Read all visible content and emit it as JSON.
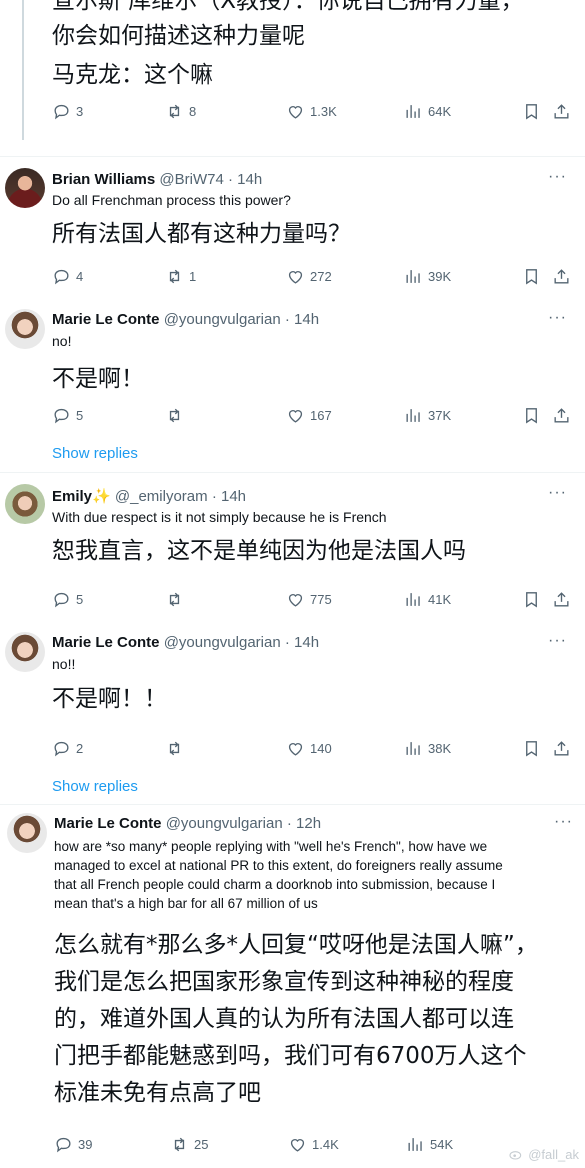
{
  "top_tweet": {
    "cut_line": "宣尔斯 库维尔（X教授）：你说自己拥有力量，",
    "text_lines": [
      "你会如何描述这种力量呢",
      "马克龙：这个嘛"
    ],
    "stats": {
      "replies": "3",
      "retweets": "8",
      "likes": "1.3K",
      "views": "64K"
    }
  },
  "tweets": [
    {
      "name": "Brian Williams",
      "handle": "@BriW74",
      "time": "14h",
      "text": "Do all Frenchman process this power?",
      "translation": [
        "所有法国人都有这种力量吗？"
      ],
      "stats": {
        "replies": "4",
        "retweets": "1",
        "likes": "272",
        "views": "39K"
      }
    },
    {
      "name": "Marie Le Conte",
      "handle": "@youngvulgarian",
      "time": "14h",
      "text": "no!",
      "translation": [
        "不是啊！"
      ],
      "stats": {
        "replies": "5",
        "retweets": "",
        "likes": "167",
        "views": "37K"
      },
      "show_replies": "Show replies"
    },
    {
      "name": "Emily",
      "badge": "✨",
      "handle": "@_emilyoram",
      "time": "14h",
      "text": "With due respect is it not simply because he is French",
      "translation": [
        "恕我直言，这不是单纯因为他是法国人吗"
      ],
      "stats": {
        "replies": "5",
        "retweets": "",
        "likes": "775",
        "views": "41K"
      }
    },
    {
      "name": "Marie Le Conte",
      "handle": "@youngvulgarian",
      "time": "14h",
      "text": "no!!",
      "translation": [
        "不是啊！！"
      ],
      "stats": {
        "replies": "2",
        "retweets": "",
        "likes": "140",
        "views": "38K"
      },
      "show_replies": "Show replies"
    },
    {
      "name": "Marie Le Conte",
      "handle": "@youngvulgarian",
      "time": "12h",
      "text_lines": [
        "how are *so many* people replying with \"well he's French\", how have we",
        "managed to excel at national PR to this extent, do foreigners really assume",
        "that all French people could charm a doorknob into submission, because I",
        "mean that's a high bar for all 67 million of us"
      ],
      "translation": [
        "怎么就有*那么多*人回复“哎呀他是法国人嘛”，",
        "我们是怎么把国家形象宣传到这种神秘的程度",
        "的，难道外国人真的认为所有法国人都可以连",
        "门把手都能魅惑到吗，我们可有6700万人这个",
        "标准未免有点高了吧"
      ],
      "stats": {
        "replies": "39",
        "retweets": "25",
        "likes": "1.4K",
        "views": "54K"
      }
    }
  ],
  "icons": {
    "reply": "reply-icon",
    "retweet": "retweet-icon",
    "like": "heart-icon",
    "views": "views-icon",
    "bookmark": "bookmark-icon",
    "share": "share-icon",
    "more": "more-icon"
  },
  "more_glyph": "···",
  "watermark": "@fall_ak",
  "colors": {
    "link": "#1d9bf0",
    "muted": "#536471",
    "thread_line": "#cfd9de",
    "text": "#0f1419"
  }
}
